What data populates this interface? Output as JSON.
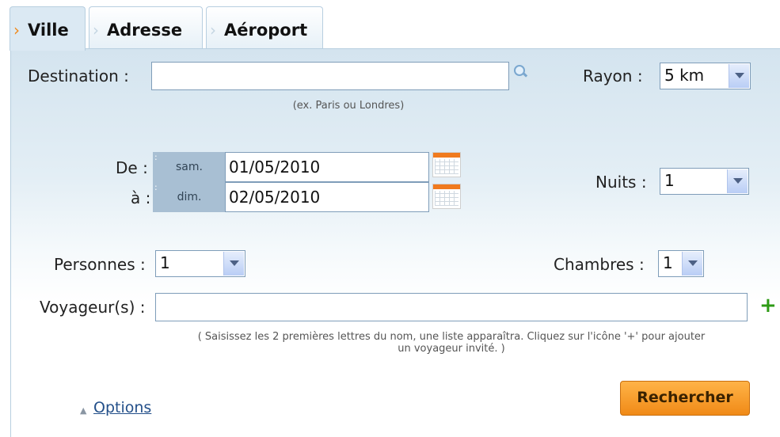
{
  "tabs": [
    {
      "label": "Ville",
      "active": true
    },
    {
      "label": "Adresse",
      "active": false
    },
    {
      "label": "Aéroport",
      "active": false
    }
  ],
  "form": {
    "destination": {
      "label": "Destination :",
      "value": "",
      "hint": "(ex. Paris ou Londres)"
    },
    "rayon": {
      "label": "Rayon :",
      "selected": "5 km"
    },
    "de": {
      "label": "De :",
      "day": "sam.",
      "date": "01/05/2010"
    },
    "a": {
      "label": "à :",
      "day": "dim.",
      "date": "02/05/2010"
    },
    "nuits": {
      "label": "Nuits :",
      "selected": "1"
    },
    "personnes": {
      "label": "Personnes :",
      "selected": "1"
    },
    "chambres": {
      "label": "Chambres :",
      "selected": "1"
    },
    "voyageurs": {
      "label": "Voyageur(s) :",
      "value": "",
      "hint_line1": "( Saisissez les 2 premières lettres du nom, une liste apparaîtra. Cliquez sur l'icône '+' pour ajouter",
      "hint_line2": "un voyageur invité. )"
    },
    "options_link": "Options",
    "search_button": "Rechercher"
  },
  "colors": {
    "accent": "#f08a17",
    "panel_bg": "#d4e4ef",
    "day_badge": "#a8bfd3",
    "plus": "#2e9b15",
    "link": "#24508a"
  },
  "icons": {
    "search": "search-icon",
    "calendar": "calendar-icon",
    "plus": "add-traveler-icon",
    "options_toggle": "triangle-up-icon"
  }
}
